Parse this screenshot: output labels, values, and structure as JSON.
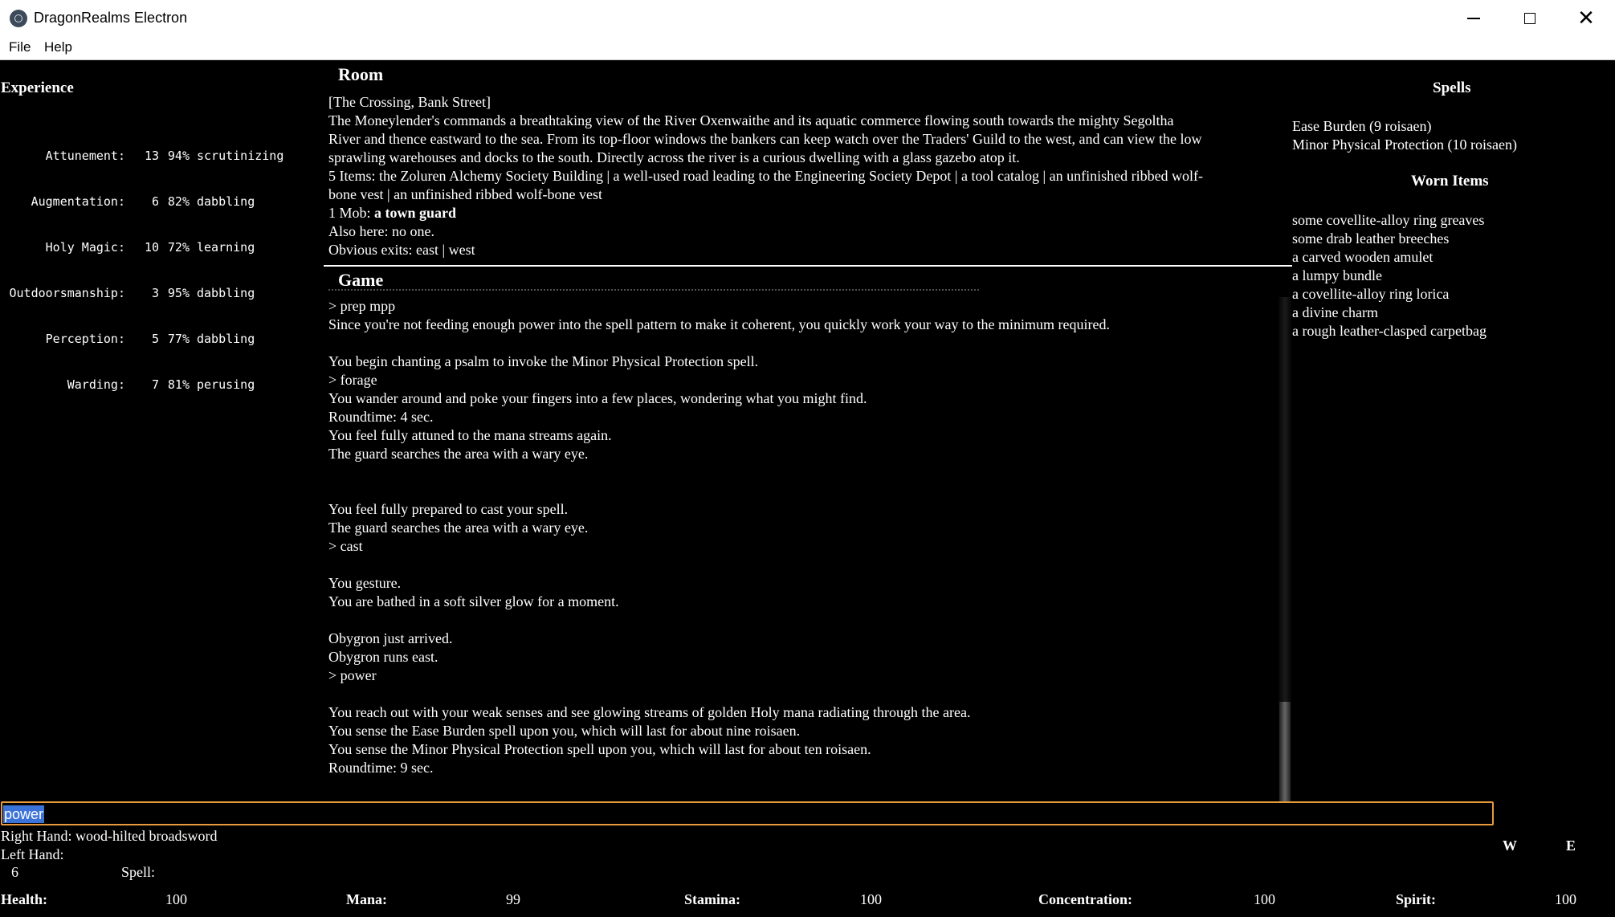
{
  "window": {
    "title": "DragonRealms Electron"
  },
  "menu": {
    "file": "File",
    "help": "Help"
  },
  "experience": {
    "title": "Experience",
    "rows": [
      {
        "skill": "Attunement:",
        "rank": "13",
        "pct": "94%",
        "state": "scrutinizing"
      },
      {
        "skill": "Augmentation:",
        "rank": "6",
        "pct": "82%",
        "state": "dabbling"
      },
      {
        "skill": "Holy Magic:",
        "rank": "10",
        "pct": "72%",
        "state": "learning"
      },
      {
        "skill": "Outdoorsmanship:",
        "rank": "3",
        "pct": "95%",
        "state": "dabbling"
      },
      {
        "skill": "Perception:",
        "rank": "5",
        "pct": "77%",
        "state": "dabbling"
      },
      {
        "skill": "Warding:",
        "rank": "7",
        "pct": "81%",
        "state": "perusing"
      }
    ]
  },
  "room": {
    "title": "Room",
    "name": "[The Crossing, Bank Street]",
    "desc1": "The Moneylender's commands a breathtaking view of the River Oxenwaithe and its aquatic commerce flowing south towards the mighty Segoltha",
    "desc2": "River and thence eastward to the sea. From its top-floor windows the bankers can keep watch over the Traders' Guild to the west, and can view the low",
    "desc3": "sprawling warehouses and docks to the south. Directly across the river is a curious dwelling with a glass gazebo atop it.",
    "items1": "5 Items: the Zoluren Alchemy Society Building | a well-used road leading to the Engineering Society Depot | a tool catalog | an unfinished ribbed wolf-",
    "items2": "bone vest | an unfinished ribbed wolf-bone vest",
    "mob_label": "1 Mob: ",
    "mob_name": "a town guard",
    "also_here": "Also here: no one.",
    "exits": "Obvious exits: east | west"
  },
  "game": {
    "title": "Game",
    "log": [
      "> prep mpp",
      "Since you're not feeding enough power into the spell pattern to make it coherent, you quickly work your way to the minimum required.",
      "",
      "You begin chanting a psalm to invoke the Minor Physical Protection spell.",
      "> forage",
      "You wander around and poke your fingers into a few places, wondering what you might find.",
      "Roundtime: 4 sec.",
      "You feel fully attuned to the mana streams again.",
      "The guard searches the area with a wary eye.",
      "",
      "",
      "You feel fully prepared to cast your spell.",
      "The guard searches the area with a wary eye.",
      "> cast",
      "",
      "You gesture.",
      "You are bathed in a soft silver glow for a moment.",
      "",
      "Obygron just arrived.",
      "Obygron runs east.",
      "> power",
      "",
      "You reach out with your weak senses and see glowing streams of golden Holy mana radiating through the area.",
      "You sense the Ease Burden spell upon you, which will last for about nine roisaen.",
      "You sense the Minor Physical Protection spell upon you, which will last for about ten roisaen.",
      "Roundtime: 9 sec."
    ]
  },
  "spells": {
    "title": "Spells",
    "items": [
      "Ease Burden (9 roisaen)",
      "Minor Physical Protection (10 roisaen)"
    ]
  },
  "worn": {
    "title": "Worn Items",
    "items": [
      "some covellite-alloy ring greaves",
      "some drab leather breeches",
      "a carved wooden amulet",
      "a lumpy bundle",
      "a covellite-alloy ring lorica",
      "a divine charm",
      "a rough leather-clasped carpetbag"
    ]
  },
  "command": {
    "value": "power"
  },
  "hands": {
    "right": "Right Hand: wood-hilted broadsword",
    "left": "Left Hand:",
    "roundtime": "6",
    "spell_label": "Spell:"
  },
  "compass": {
    "w": "W",
    "e": "E"
  },
  "vitals": {
    "health_label": "Health:",
    "health": "100",
    "mana_label": "Mana:",
    "mana": "99",
    "stamina_label": "Stamina:",
    "stamina": "100",
    "concentration_label": "Concentration:",
    "concentration": "100",
    "spirit_label": "Spirit:",
    "spirit": "100"
  },
  "colors": {
    "background": "#000000",
    "text": "#ffffff",
    "input_border": "#e89a3c",
    "selection": "#3b73d9"
  }
}
